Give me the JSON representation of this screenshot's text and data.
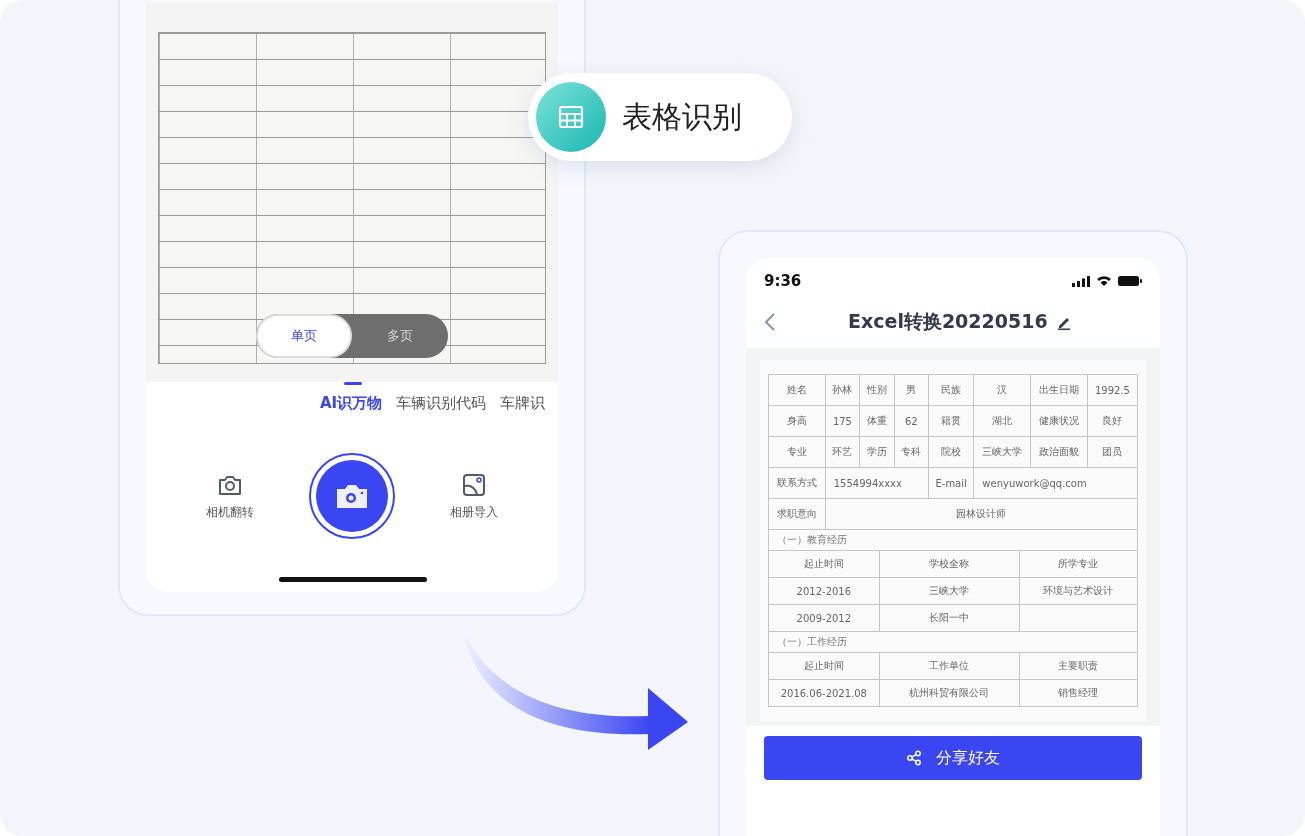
{
  "camera_screen": {
    "page_toggle": [
      {
        "label": "单页",
        "selected": true
      },
      {
        "label": "多页",
        "selected": false
      }
    ],
    "mode_tabs": [
      {
        "label": "AI识万物",
        "selected": true
      },
      {
        "label": "车辆识别代码",
        "selected": false
      },
      {
        "label": "车牌识",
        "selected": false
      }
    ],
    "controls": [
      {
        "kind": "flip",
        "label": "相机翻转"
      },
      {
        "kind": "shutter"
      },
      {
        "kind": "album",
        "label": "相册导入"
      }
    ]
  },
  "feature_badge": {
    "label": "表格识别"
  },
  "result_screen": {
    "status_bar": {
      "time": "9:36"
    },
    "title": "Excel转换20220516",
    "info_rows": [
      [
        "姓名",
        "孙林",
        "性别",
        "男",
        "民族",
        "汉",
        "出生日期",
        "1992.5"
      ],
      [
        "身高",
        "175",
        "体重",
        "62",
        "籍贯",
        "湖北",
        "健康状况",
        "良好"
      ],
      [
        "专业",
        "环艺",
        "学历",
        "专科",
        "院校",
        "三峡大学",
        "政治面貌",
        "团员"
      ],
      [
        "联系方式",
        "1554994xxxx",
        "E-mail",
        "wenyuwork@qq.com"
      ],
      [
        "求职意向",
        "园林设计师"
      ]
    ],
    "sections": [
      {
        "heading": "（一）教育经历",
        "rows": [
          [
            "起止时间",
            "学校全称",
            "所学专业"
          ],
          [
            "2012-2016",
            "三峡大学",
            "环境与艺术设计"
          ],
          [
            "2009-2012",
            "长阳一中"
          ]
        ]
      },
      {
        "heading": "（一）工作经历",
        "rows": [
          [
            "起止时间",
            "工作单位",
            "主要职责"
          ],
          [
            "2016.06-2021.08",
            "杭州科贸有限公司",
            "销售经理"
          ]
        ]
      }
    ],
    "share_button": "分享好友"
  }
}
